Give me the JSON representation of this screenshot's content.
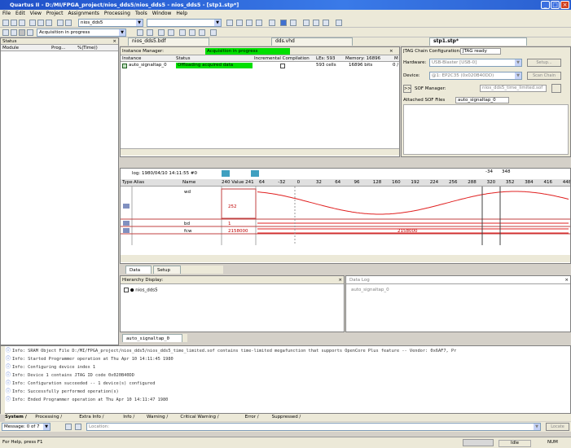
{
  "window": {
    "title": "Quartus II - D:/MI/FPGA_project/nios_dds5/nios_dds5 - nios_dds5 - [stp1.stp*]"
  },
  "menu": [
    "File",
    "Edit",
    "View",
    "Project",
    "Assignments",
    "Processing",
    "Tools",
    "Window",
    "Help"
  ],
  "toolbar": {
    "project_combo": "nios_dds5",
    "status_combo": "Acquisition in progress"
  },
  "status_pane": {
    "title": "Status",
    "columns": [
      "Module",
      "Prog...",
      "%|Time()"
    ]
  },
  "tabs": {
    "bdf": "nios_dds5.bdf",
    "vhd": "dds.vhd",
    "stp": "stp1.stp*"
  },
  "instance_manager": {
    "label": "Instance Manager:",
    "status": "Acquisition in progress",
    "columns": [
      "Instance",
      "Status",
      "Incremental Compilation",
      "LEs: 593",
      "Memory: 16896",
      "M"
    ],
    "rows": [
      {
        "instance": "auto_signaltap_0",
        "status": "Offloading acquired data",
        "les": "593 cells",
        "memory": "16896 bits",
        "m": "0 /"
      }
    ]
  },
  "jtag": {
    "config_label": "JTAG Chain Configuration:",
    "config_value": "JTAG ready",
    "hardware_label": "Hardware:",
    "hardware_value": "USB-Blaster [USB-0]",
    "setup": "Setup...",
    "device_label": "Device:",
    "device_value": "@1: EP2C35 (0x020B40DD)",
    "scan": "Scan Chain",
    "sof_label": "SOF Manager:",
    "sof_value": "nios_dds5_time_limited.sof",
    "attached_label": "Attached SOF Files",
    "attached_value": "auto_signaltap_0"
  },
  "waveform": {
    "log": "log: 1980/04/10 14:11:55  #0",
    "col_type": "Type",
    "col_alias": "Alias",
    "col_name": "Name",
    "col_value": "240 Value 241",
    "ticks": [
      "64",
      "-32",
      "0",
      "32",
      "64",
      "96",
      "128",
      "160",
      "192",
      "224",
      "256",
      "288",
      "320",
      "352",
      "384",
      "416",
      "448"
    ],
    "top_ticks": [
      "-34",
      "348"
    ],
    "signals": [
      {
        "name": "wd",
        "value": "252"
      },
      {
        "name": "bd",
        "value": "1"
      },
      {
        "name": "fcw",
        "value": "2158000",
        "mid": "2158000"
      }
    ]
  },
  "bottom_tabs": {
    "data": "Data",
    "setup": "Setup"
  },
  "hierarchy": {
    "title": "Hierarchy Display:",
    "root": "nios_dds5",
    "datalog": "Data Log",
    "datalog_item": "auto_signaltap_0"
  },
  "instance_tab": "auto_signaltap_0",
  "messages": [
    "Info: SRAM Object File D:/MI/FPGA_project/nios_dds5/nios_dds5_time_limited.sof contains time-limited megafunction that supports OpenCore Plus feature -- Vendor: 0x6AF7, Pr",
    "Info: Started Programmer operation at Thu Apr 10 14:11:45 1980",
    "Info: Configuring device index 1",
    "Info: Device 1 contains JTAG ID code 0x020B40DD",
    "Info: Configuration succeeded -- 1 device(s) configured",
    "Info: Successfully performed operation(s)",
    "Info: Ended Programmer operation at Thu Apr 10 14:11:47 1980"
  ],
  "msg_tabs": [
    "System",
    "Processing",
    "Extra Info",
    "Info",
    "Warning",
    "Critical Warning",
    "Error",
    "Suppressed"
  ],
  "msg_counter": "Message: 0 of 7",
  "location_placeholder": "Location:",
  "locate_btn": "Locate",
  "statusbar": {
    "help": "For Help, press F1",
    "idle": "Idle",
    "num": "NUM"
  }
}
